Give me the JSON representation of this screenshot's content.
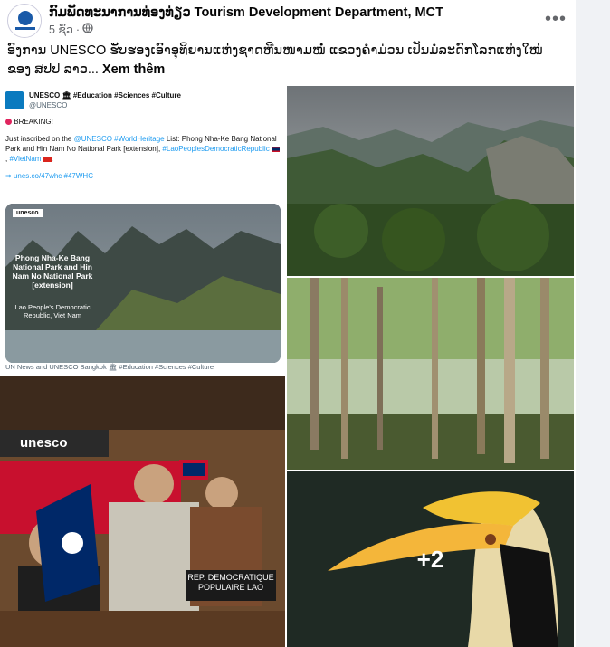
{
  "post": {
    "page_name": "ກົມພັດທະນາການທ່ອງທ່ຽວ Tourism Development Department, MCT",
    "time": "5 ຊົ່ວ",
    "caption": "ອົງການ UNESCO ຮັບຮອງເອົາອຸທິຍານແຫ່ງຊາດຫີນໜາມໜໍ່ ແຂວງຄໍາມ່ວນ ເປັນມໍລະດົກໂລກແຫ່ງໃໝ່ຂອງ ສປປ ລາວ...",
    "see_more": "Xem thêm",
    "more_count": "+2"
  },
  "tweet": {
    "name": "UNESCO 🏛 #Education #Sciences #Culture",
    "handle": "@UNESCO",
    "breaking": "BREAKING!",
    "body_prefix": "Just inscribed on the ",
    "body_link1": "@UNESCO #WorldHeritage",
    "body_mid": " List: Phong Nha-Ke Bang National Park and Hin Nam No National Park [extension], ",
    "body_link2": "#LaoPeoplesDemocraticRepublic",
    "body_link3": "#VietNam",
    "link_line": "➡ unes.co/47whc #47WHC",
    "badge": "unesco",
    "img_title": "Phong Nha-Ke Bang National Park and Hin Nam No National Park [extension]",
    "img_sub": "Lao People's Democratic Republic, Viet Nam",
    "footer": "UN News and UNESCO Bangkok 🏛 #Education #Sciences #Culture"
  },
  "photos": {
    "unesco_sign": "unesco",
    "plaque": "REP. DEMOCRATIQUE POPULAIRE LAO"
  },
  "colors": {
    "link": "#1d9bf0",
    "lao_red": "#ce1126",
    "lao_blue": "#002868"
  }
}
